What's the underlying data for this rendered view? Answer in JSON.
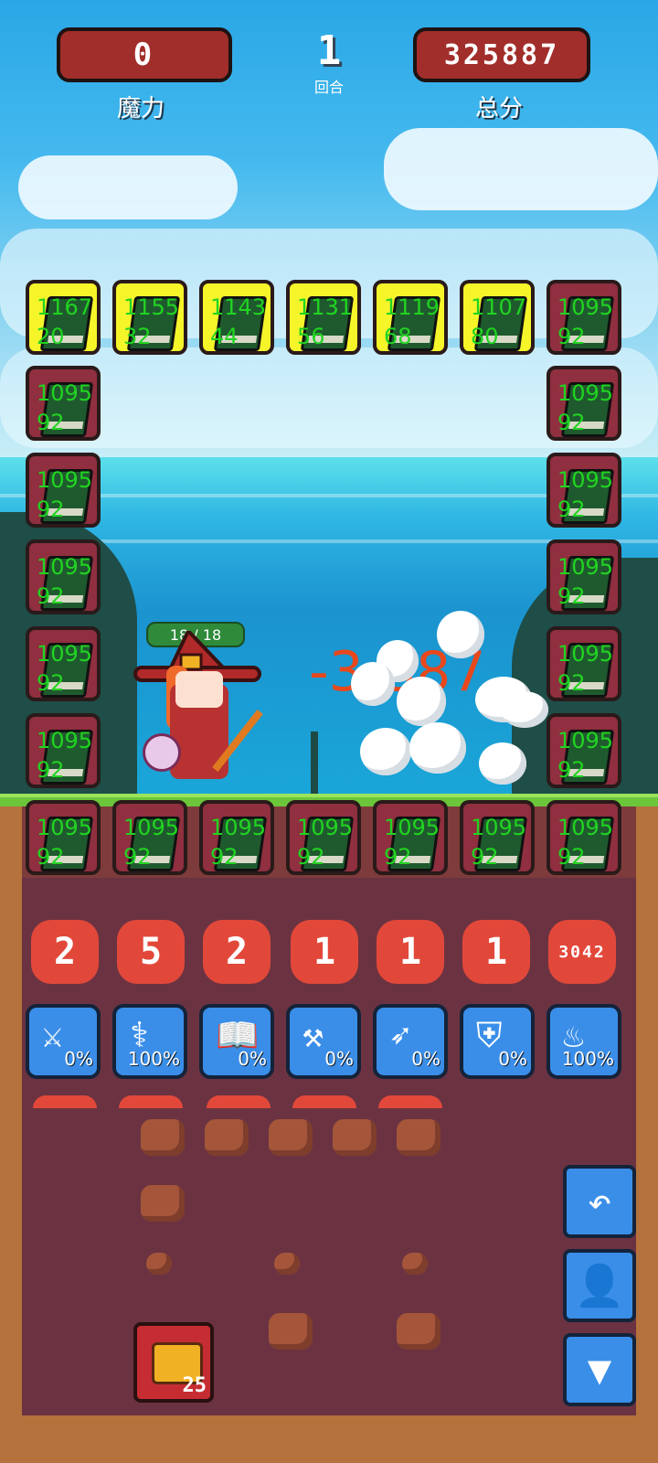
{
  "header": {
    "mana_value": "0",
    "mana_label": "魔力",
    "round_value": "1",
    "round_label": "回合",
    "score_value": "325887",
    "score_label": "总分"
  },
  "hero": {
    "hp": "18 / 18"
  },
  "damage_text": "-3  887",
  "tiles": {
    "top": [
      {
        "a": "1167",
        "b": "20",
        "highlight": true
      },
      {
        "a": "1155",
        "b": "32",
        "highlight": true
      },
      {
        "a": "1143",
        "b": "44",
        "highlight": true
      },
      {
        "a": "1131",
        "b": "56",
        "highlight": true
      },
      {
        "a": "1119",
        "b": "68",
        "highlight": true
      },
      {
        "a": "1107",
        "b": "80",
        "highlight": true
      },
      {
        "a": "1095",
        "b": "92",
        "highlight": false
      }
    ],
    "left": [
      {
        "a": "1095",
        "b": "92"
      },
      {
        "a": "1095",
        "b": "92"
      },
      {
        "a": "1095",
        "b": "92"
      },
      {
        "a": "1095",
        "b": "92"
      },
      {
        "a": "1095",
        "b": "92"
      }
    ],
    "right": [
      {
        "a": "1095",
        "b": "92"
      },
      {
        "a": "1095",
        "b": "92"
      },
      {
        "a": "1095",
        "b": "92"
      },
      {
        "a": "1095",
        "b": "92"
      },
      {
        "a": "1095",
        "b": "92"
      }
    ],
    "bottom": [
      {
        "a": "1095",
        "b": "92"
      },
      {
        "a": "1095",
        "b": "92"
      },
      {
        "a": "1095",
        "b": "92"
      },
      {
        "a": "1095",
        "b": "92"
      },
      {
        "a": "1095",
        "b": "92"
      },
      {
        "a": "1095",
        "b": "92"
      },
      {
        "a": "1095",
        "b": "92"
      }
    ]
  },
  "counts": [
    "2",
    "5",
    "2",
    "1",
    "1",
    "1",
    "3042"
  ],
  "skills": [
    {
      "icon": "sword-icon",
      "glyph": "⚔",
      "pct": "0%"
    },
    {
      "icon": "cane-icon",
      "glyph": "⚕",
      "pct": "100%"
    },
    {
      "icon": "spellbook-icon",
      "glyph": "📖",
      "pct": "0%"
    },
    {
      "icon": "axe-icon",
      "glyph": "⚒",
      "pct": "0%"
    },
    {
      "icon": "bow-icon",
      "glyph": "➶",
      "pct": "0%"
    },
    {
      "icon": "shield-icon",
      "glyph": "⛨",
      "pct": "0%"
    },
    {
      "icon": "fire-icon",
      "glyph": "♨",
      "pct": "100%"
    }
  ],
  "chest": {
    "count": "25"
  },
  "side_buttons": [
    {
      "icon": "undo-icon",
      "glyph": "↶"
    },
    {
      "icon": "profile-icon",
      "glyph": "👤"
    },
    {
      "icon": "down-arrow-icon",
      "glyph": "▼"
    }
  ],
  "colors": {
    "accent_red": "#e2483a",
    "panel_blue": "#3a8ee8",
    "tile_highlight": "#f6f52a",
    "tile_text": "#21d421"
  }
}
